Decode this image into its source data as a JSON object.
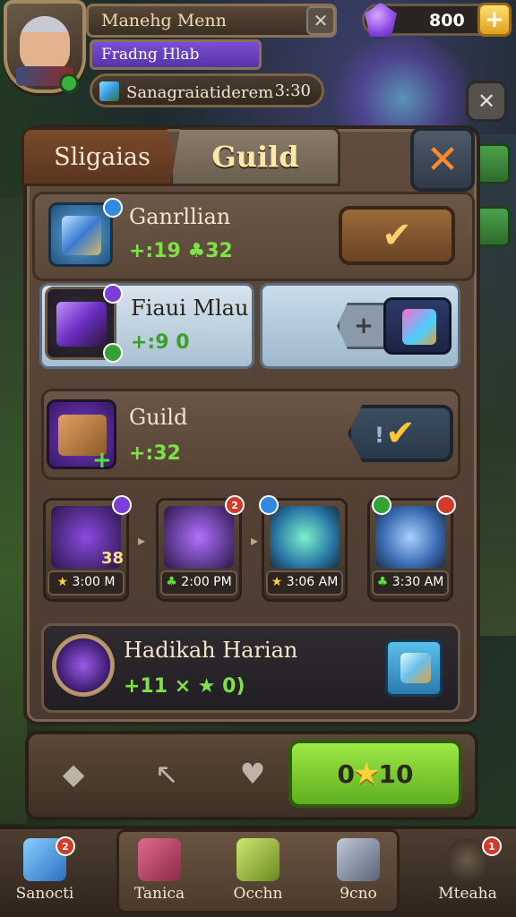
{
  "player": {
    "name": "Manehg Menn",
    "title": "Fradng Hlab",
    "level_badge": "",
    "status_text": "Sanagraiatiderem",
    "status_time": "3:30"
  },
  "currency": {
    "amount": "800"
  },
  "tabs": [
    {
      "label": "Sligaias",
      "active": false
    },
    {
      "label": "Guild",
      "active": true
    }
  ],
  "rows": {
    "row1": {
      "title": "Ganrllian",
      "stat": "+:19 ♣32",
      "badge": ""
    },
    "row2": {
      "title": "Fiaui Mlau",
      "stat": "+:9 0",
      "badge_top": "",
      "badge_bottom": ""
    },
    "row3": {
      "title": "Guild",
      "stat": "+:32",
      "dot": "!"
    },
    "rewards": [
      {
        "time": "3:00 M",
        "icon": "star-icon",
        "badge": "",
        "badge_color": "purple"
      },
      {
        "time": "2:00 PM",
        "icon": "clover-icon",
        "badge": "2",
        "badge_color": "red"
      },
      {
        "time": "3:06 AM",
        "icon": "star-icon",
        "badge": "",
        "badge_color": "blue"
      },
      {
        "time": "3:30 AM",
        "icon": "clover-icon",
        "badge": "",
        "badge_color": "red"
      }
    ],
    "reward_1_extra": "38",
    "row5": {
      "title": "Hadikah Harian",
      "stat": "+11 × ★ 0)"
    }
  },
  "actions": {
    "go_left": "0",
    "go_right": "10"
  },
  "nav": [
    {
      "label": "Sanocti",
      "icon": "cube-icon",
      "badge": "2"
    },
    {
      "label": "Tanica",
      "icon": "chest-icon",
      "badge": ""
    },
    {
      "label": "Occhn",
      "icon": "block-icon",
      "badge": ""
    },
    {
      "label": "9cno",
      "icon": "gear-block-icon",
      "badge": ""
    },
    {
      "label": "Mteaha",
      "icon": "headset-icon",
      "badge": "1"
    }
  ],
  "colors": {
    "accent_green": "#7fe04a",
    "accent_gold": "#ffd070",
    "tab_active": "#ffe8a8",
    "close_orange": "#ff8a2a"
  }
}
